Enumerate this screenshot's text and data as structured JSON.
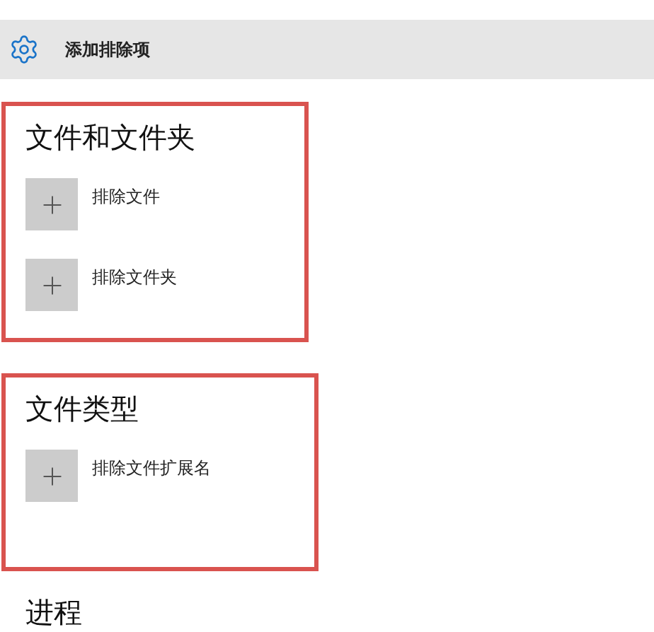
{
  "header": {
    "label": "添加排除项"
  },
  "sections": [
    {
      "title": "文件和文件夹",
      "highlighted": true,
      "items": [
        {
          "label": "排除文件"
        },
        {
          "label": "排除文件夹"
        }
      ]
    },
    {
      "title": "文件类型",
      "highlighted": true,
      "items": [
        {
          "label": "排除文件扩展名"
        }
      ]
    },
    {
      "title": "进程",
      "highlighted": false
    }
  ]
}
